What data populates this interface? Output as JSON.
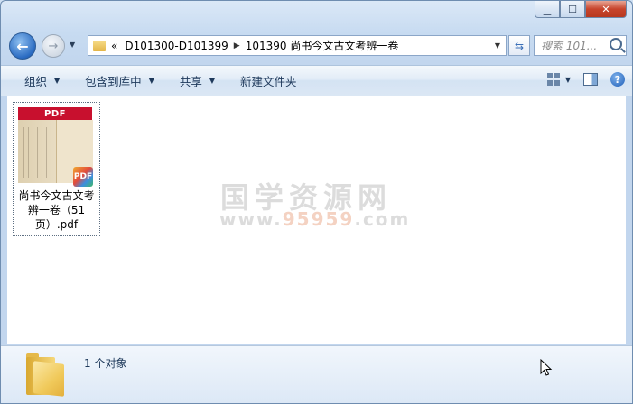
{
  "window": {
    "caption_buttons": {
      "minimize": "▁",
      "maximize": "☐",
      "close": "✕"
    }
  },
  "nav": {
    "back_glyph": "←",
    "forward_glyph": "→",
    "address": {
      "prefix": "«",
      "segments": [
        "D101300-D101399",
        "101390 尚书今文古文考辨一卷"
      ]
    },
    "search_placeholder": "搜索 101..."
  },
  "toolbar": {
    "items": [
      {
        "label": "组织"
      },
      {
        "label": "包含到库中"
      },
      {
        "label": "共享"
      },
      {
        "label": "新建文件夹"
      }
    ],
    "help_glyph": "?"
  },
  "files": [
    {
      "name": "尚书今文古文考辨一卷（51页）.pdf",
      "thumb_band_text": "PDF",
      "badge_text": "PDF"
    }
  ],
  "watermark": {
    "title": "国学资源网",
    "url_prefix": "www.",
    "url_highlight": "95959",
    "url_suffix": ".com"
  },
  "status": {
    "count_text": "1 个对象"
  },
  "colors": {
    "accent": "#1e395b",
    "pdf_red": "#c8102e",
    "close_red": "#c7442c"
  }
}
